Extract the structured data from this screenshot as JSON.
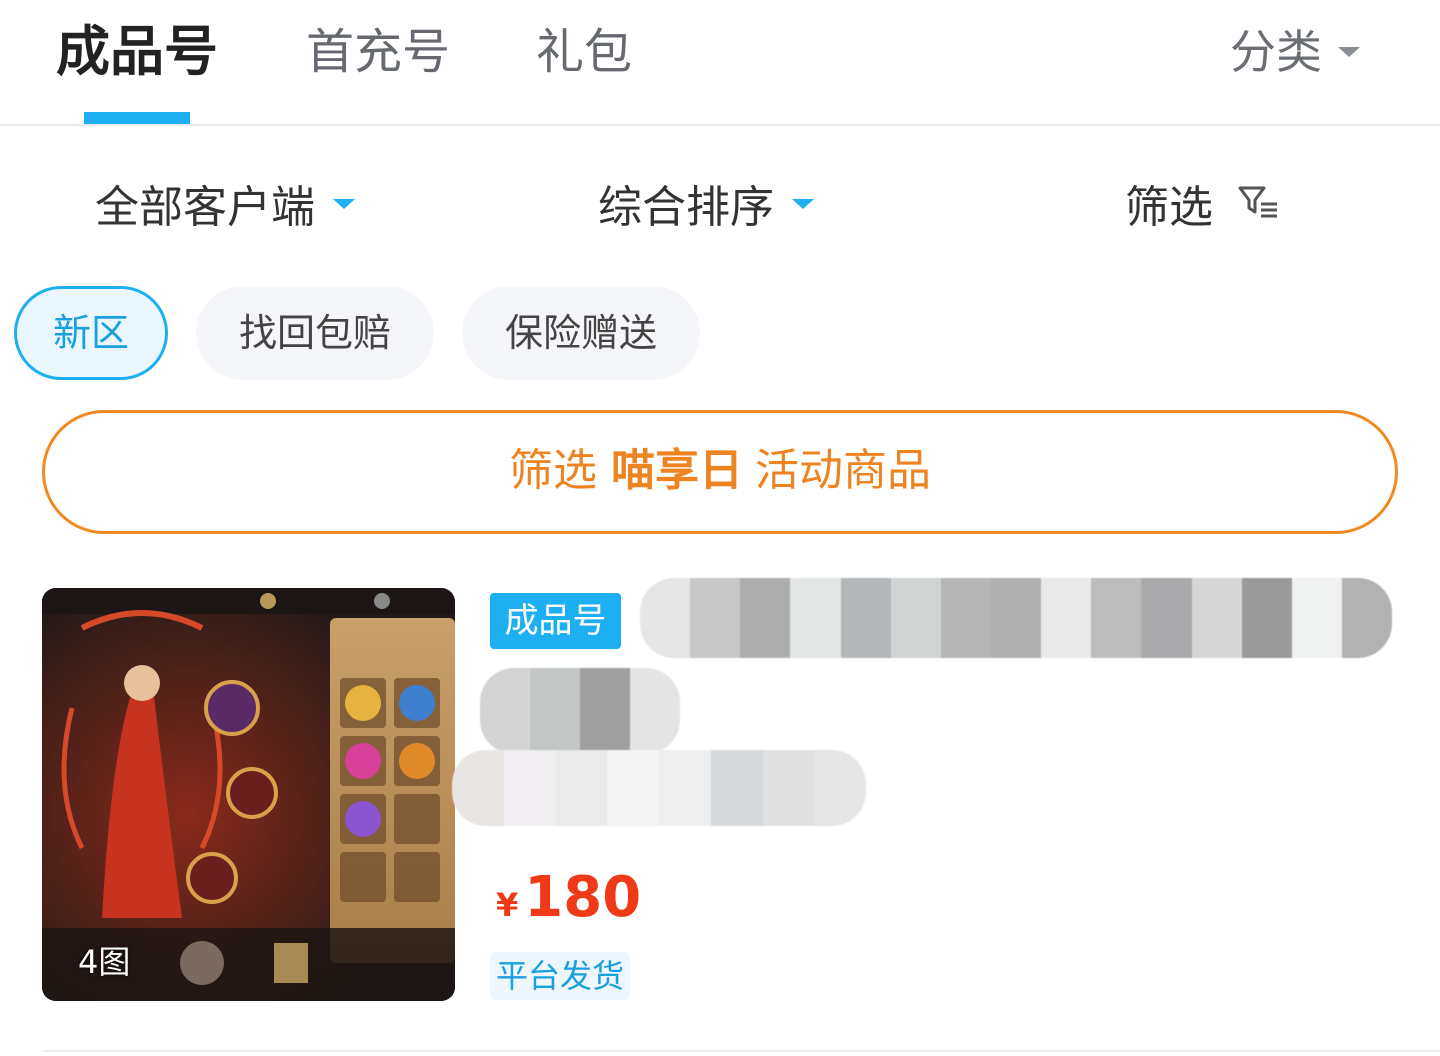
{
  "tabs": {
    "items": [
      {
        "label": "成品号",
        "active": true
      },
      {
        "label": "首充号",
        "active": false
      },
      {
        "label": "礼包",
        "active": false
      }
    ],
    "category_label": "分类"
  },
  "filters": {
    "client": "全部客户端",
    "sort": "综合排序",
    "filter": "筛选"
  },
  "chips": [
    {
      "label": "新区",
      "selected": true
    },
    {
      "label": "找回包赔",
      "selected": false
    },
    {
      "label": "保险赠送",
      "selected": false
    }
  ],
  "promo": {
    "prefix": "筛选",
    "highlight": "喵享日",
    "suffix": "活动商品"
  },
  "product": {
    "image_count": "4图",
    "badge": "成品号",
    "currency": "¥",
    "price": "180",
    "shipping": "平台发货"
  },
  "colors": {
    "accent_blue": "#1eaff2",
    "promo_orange": "#ee8421",
    "price_red": "#f03a17"
  }
}
